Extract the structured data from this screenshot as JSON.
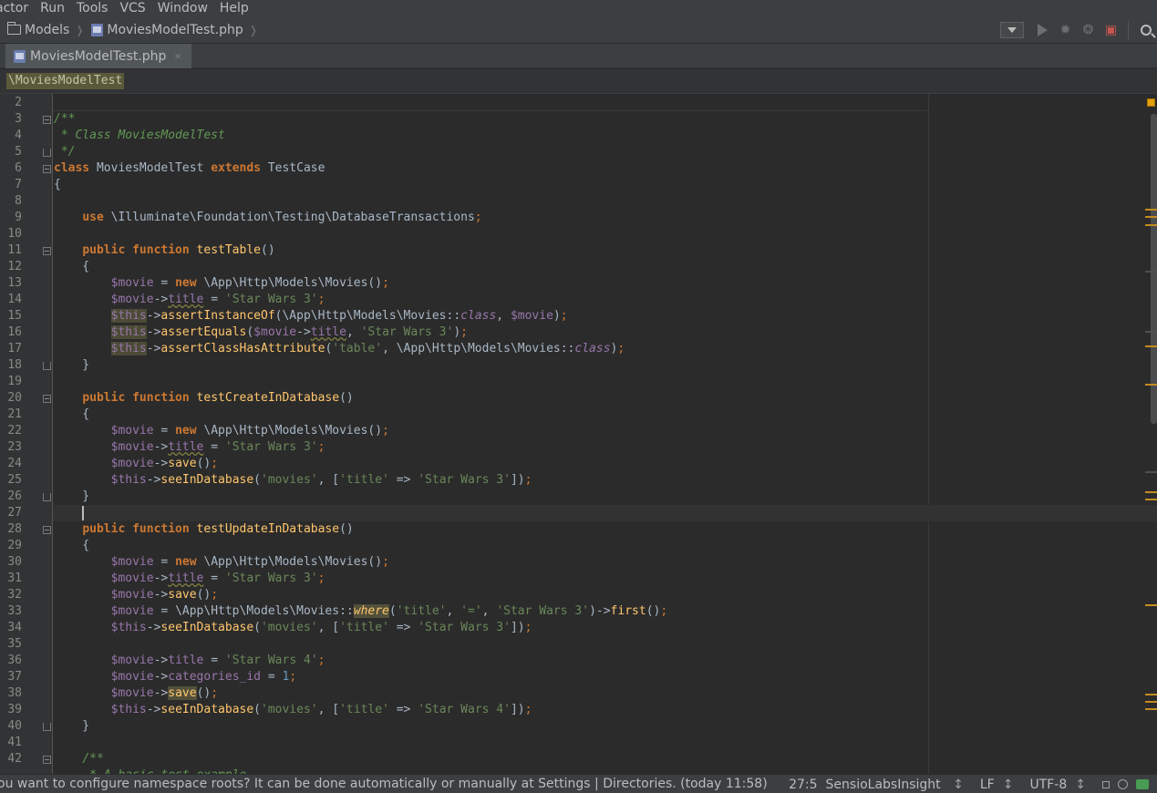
{
  "menu": {
    "items": [
      {
        "label": "actor"
      },
      {
        "label": "Run"
      },
      {
        "label": "Tools"
      },
      {
        "label": "VCS"
      },
      {
        "label": "Window"
      },
      {
        "label": "Help"
      }
    ]
  },
  "navbar": {
    "crumbs": [
      {
        "label": "Models",
        "icon": "folder-icon"
      },
      {
        "label": "MoviesModelTest.php",
        "icon": "php-file-icon"
      }
    ],
    "tools": [
      "run-config-dropdown",
      "run-icon",
      "debug-icon",
      "coverage-icon",
      "vcs-icon",
      "search-icon"
    ]
  },
  "tabs": [
    {
      "label": "MoviesModelTest.php",
      "close": "×",
      "active": true
    }
  ],
  "structure_crumb": "\\MoviesModelTest",
  "editor": {
    "line_numbers": [
      "2",
      "3",
      "4",
      "5",
      "6",
      "7",
      "8",
      "9",
      "10",
      "11",
      "12",
      "13",
      "14",
      "15",
      "16",
      "17",
      "18",
      "19",
      "20",
      "21",
      "22",
      "23",
      "24",
      "25",
      "26",
      "27",
      "28",
      "29",
      "30",
      "31",
      "32",
      "33",
      "34",
      "35",
      "36",
      "37",
      "38",
      "39",
      "40",
      "41",
      "42"
    ],
    "caret_line": "27"
  },
  "status": {
    "message": "ou want to configure namespace roots? It can be done automatically or manually at Settings | Directories. (today 11:58)",
    "position": "27:5",
    "plugin": "SensioLabsInsight",
    "line_separator": "LF",
    "encoding": "UTF-8"
  },
  "colors": {
    "background": "#2b2b2b",
    "keyword": "#cc7832",
    "string": "#6a8759",
    "variable": "#9876aa",
    "method": "#ffc66d",
    "comment": "#629755",
    "number": "#6897bb"
  }
}
